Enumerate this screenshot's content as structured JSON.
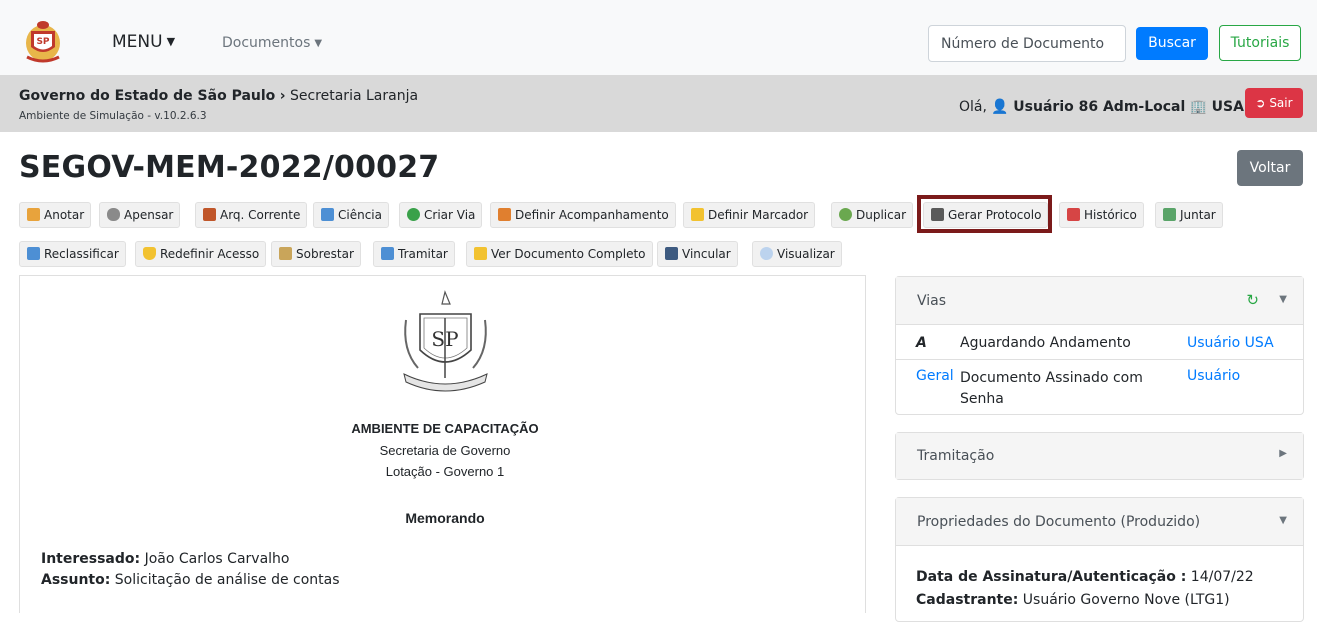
{
  "navbar": {
    "menu_label": "MENU",
    "docs_label": "Documentos",
    "search_placeholder": "Número de Documento",
    "search_button": "Buscar",
    "tutorials_button": "Tutoriais"
  },
  "breadcrumb": {
    "root": "Governo do Estado de São Paulo",
    "separator": "›",
    "current": "Secretaria Laranja",
    "environment": "Ambiente de Simulação - v.10.2.6.3"
  },
  "user": {
    "greeting": "Olá,",
    "name": "Usuário 86 Adm-Local",
    "org": "USA",
    "logout": "Sair"
  },
  "document": {
    "title": "SEGOV-MEM-2022/00027",
    "back_button": "Voltar"
  },
  "toolbar_row1": [
    {
      "label": "Anotar",
      "icon": "note-icon"
    },
    {
      "label": "Apensar",
      "icon": "link-icon"
    },
    {
      "label": "Arq. Corrente",
      "icon": "archive-icon"
    },
    {
      "label": "Ciência",
      "icon": "doc-check-icon"
    },
    {
      "label": "Criar Via",
      "icon": "add-circle-icon"
    },
    {
      "label": "Definir Acompanhamento",
      "icon": "person-icon"
    },
    {
      "label": "Definir Marcador",
      "icon": "folder-tag-icon"
    },
    {
      "label": "Duplicar",
      "icon": "duplicate-icon"
    },
    {
      "label": "Gerar Protocolo",
      "icon": "printer-icon"
    },
    {
      "label": "Histórico",
      "icon": "calendar-icon"
    },
    {
      "label": "Juntar",
      "icon": "attach-icon"
    }
  ],
  "toolbar_row2": [
    {
      "label": "Reclassificar",
      "icon": "reclassify-icon"
    },
    {
      "label": "Redefinir Acesso",
      "icon": "shield-icon"
    },
    {
      "label": "Sobrestar",
      "icon": "hourglass-icon"
    },
    {
      "label": "Tramitar",
      "icon": "send-icon"
    },
    {
      "label": "Ver Documento Completo",
      "icon": "folder-open-icon"
    },
    {
      "label": "Vincular",
      "icon": "binder-icon"
    },
    {
      "label": "Visualizar",
      "icon": "eye-icon"
    }
  ],
  "doc_body": {
    "heading": "AMBIENTE DE CAPACITAÇÃO",
    "secretaria": "Secretaria de Governo",
    "lotacao": "Lotação - Governo 1",
    "doc_type": "Memorando",
    "interessado_label": "Interessado:",
    "interessado_value": "João Carlos Carvalho",
    "assunto_label": "Assunto:",
    "assunto_value": "Solicitação de análise de contas"
  },
  "vias": {
    "title": "Vias",
    "rows": [
      {
        "via": "A",
        "status": "Aguardando Andamento",
        "user": "Usuário",
        "org": "USA"
      },
      {
        "via": "Geral",
        "status": "Documento Assinado com Senha",
        "user": "Usuário",
        "org": ""
      }
    ]
  },
  "tramitacao": {
    "title": "Tramitação"
  },
  "propriedades": {
    "title": "Propriedades do Documento (Produzido)",
    "data_label": "Data de Assinatura/Autenticação :",
    "data_value": "14/07/22",
    "cadastrante_label": "Cadastrante:",
    "cadastrante_value": "Usuário Governo Nove (LTG1)"
  },
  "colors": {
    "primary": "#007bff",
    "success": "#28a745",
    "danger": "#dc3545",
    "secondary": "#6c757d",
    "highlight_border": "#7b1a1a"
  }
}
